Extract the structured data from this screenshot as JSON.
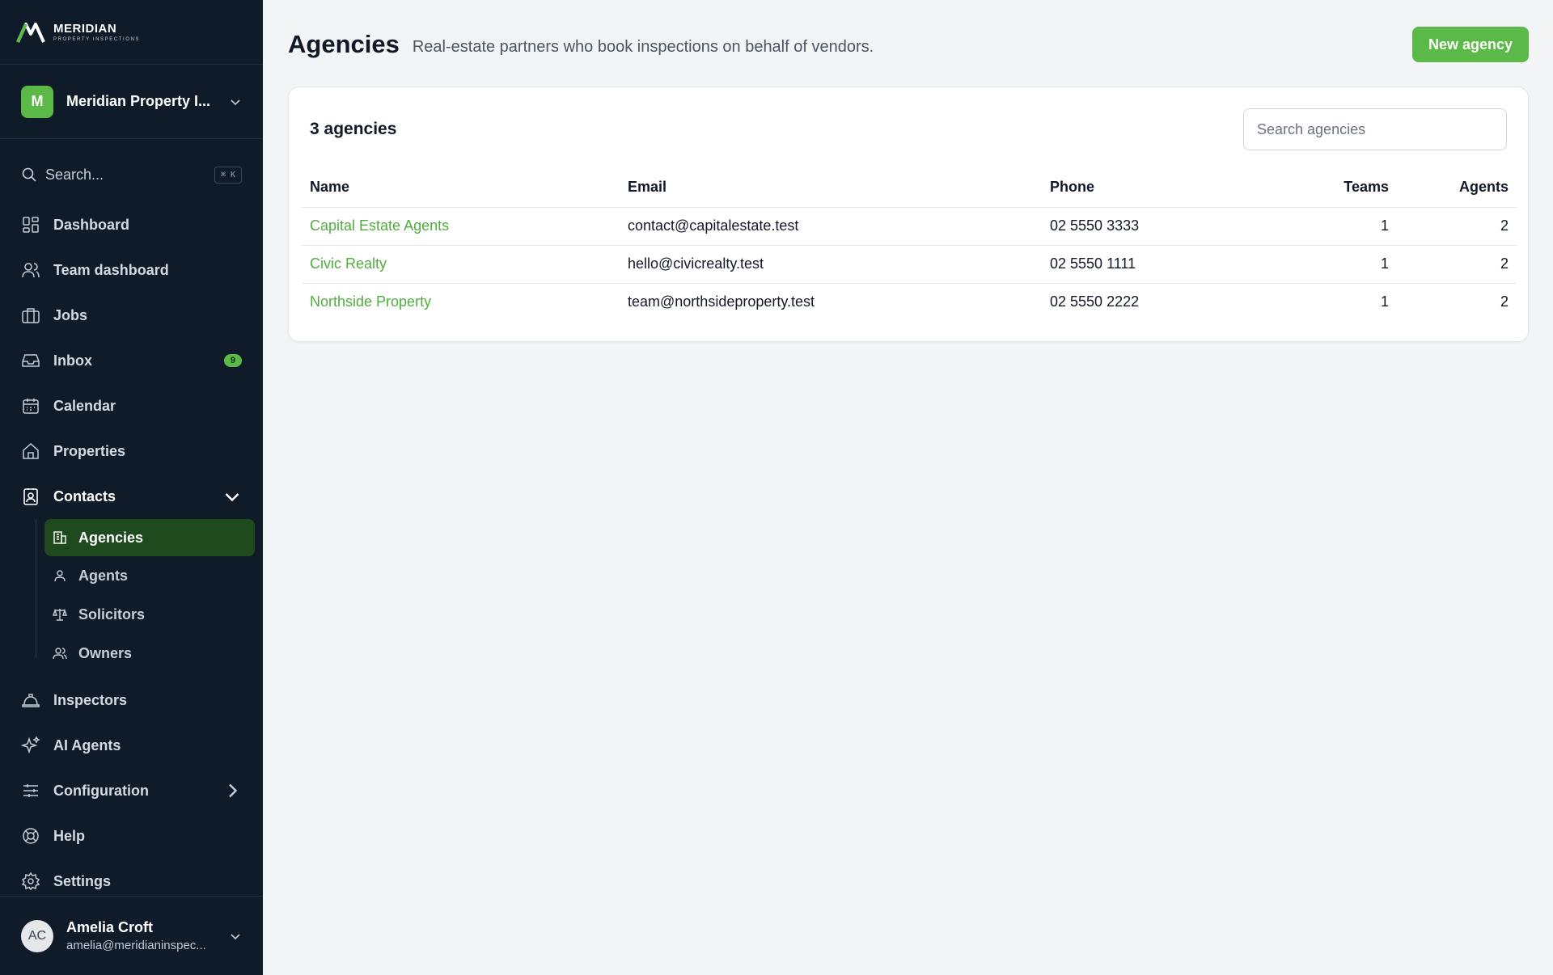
{
  "brand": {
    "name": "MERIDIAN",
    "tagline": "PROPERTY INSPECTIONS",
    "accent": "#5ab947"
  },
  "org": {
    "initial": "M",
    "name": "Meridian Property I..."
  },
  "search": {
    "label": "Search...",
    "shortcut": "⌘ K"
  },
  "nav": {
    "dashboard": "Dashboard",
    "team_dashboard": "Team dashboard",
    "jobs": "Jobs",
    "inbox": "Inbox",
    "inbox_count": "9",
    "calendar": "Calendar",
    "properties": "Properties",
    "contacts": "Contacts",
    "agencies": "Agencies",
    "agents": "Agents",
    "solicitors": "Solicitors",
    "owners": "Owners",
    "inspectors": "Inspectors",
    "ai_agents": "AI Agents",
    "configuration": "Configuration",
    "help": "Help",
    "settings": "Settings"
  },
  "user": {
    "initials": "AC",
    "name": "Amelia Croft",
    "email": "amelia@meridianinspec..."
  },
  "page": {
    "title": "Agencies",
    "subtitle": "Real-estate partners who book inspections on behalf of vendors.",
    "new_button": "New agency"
  },
  "card": {
    "count_label": "3 agencies",
    "search_placeholder": "Search agencies"
  },
  "table": {
    "headers": {
      "name": "Name",
      "email": "Email",
      "phone": "Phone",
      "teams": "Teams",
      "agents": "Agents"
    },
    "rows": [
      {
        "name": "Capital Estate Agents",
        "email": "contact@capitalestate.test",
        "phone": "02 5550 3333",
        "teams": "1",
        "agents": "2"
      },
      {
        "name": "Civic Realty",
        "email": "hello@civicrealty.test",
        "phone": "02 5550 1111",
        "teams": "1",
        "agents": "2"
      },
      {
        "name": "Northside Property",
        "email": "team@northsideproperty.test",
        "phone": "02 5550 2222",
        "teams": "1",
        "agents": "2"
      }
    ]
  }
}
